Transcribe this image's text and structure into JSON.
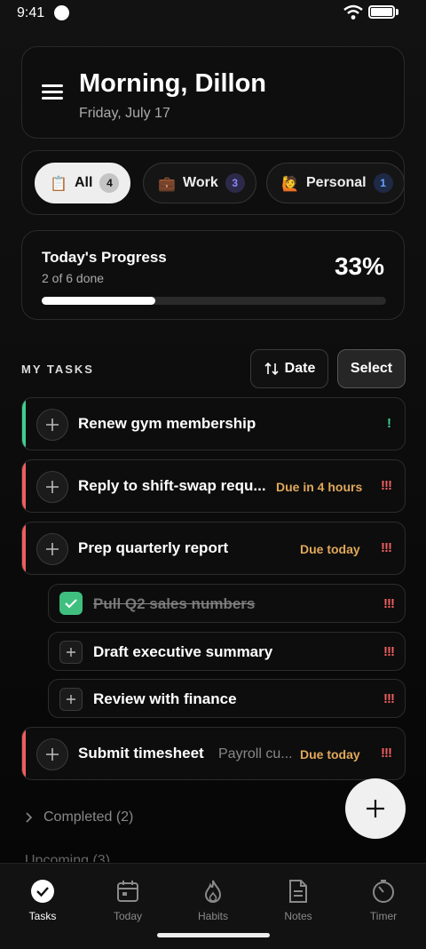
{
  "status": {
    "time": "9:41"
  },
  "header": {
    "title": "Morning, Dillon",
    "date": "Friday, July 17"
  },
  "filters": [
    {
      "label": "All",
      "count": "4",
      "icon": "clipboard-icon",
      "active": true
    },
    {
      "label": "Work",
      "count": "3",
      "icon": "briefcase-icon",
      "active": false
    },
    {
      "label": "Personal",
      "count": "1",
      "icon": "person-raising-hand-icon",
      "active": false
    }
  ],
  "progress": {
    "title": "Today's Progress",
    "subtitle": "2 of 6 done",
    "percent_label": "33%",
    "fraction": 0.33
  },
  "tasks_section": {
    "label": "MY TASKS",
    "sort_label": "Date",
    "select_label": "Select"
  },
  "tasks": [
    {
      "title": "Renew gym membership",
      "due": "",
      "priority": "!",
      "accent": "#3fcf8e"
    },
    {
      "title": "Reply to shift-swap requ...",
      "due": "Due in 4 hours",
      "priority": "!!!",
      "accent": "#ef5e5e"
    },
    {
      "title": "Prep quarterly report",
      "due": "Due today",
      "priority": "!!!",
      "accent": "#ef5e5e"
    }
  ],
  "subtasks": [
    {
      "title": "Pull Q2 sales numbers",
      "done": true,
      "priority": "!!!"
    },
    {
      "title": "Draft executive summary",
      "done": false,
      "priority": "!!!"
    },
    {
      "title": "Review with finance",
      "done": false,
      "priority": "!!!"
    }
  ],
  "task_last": {
    "title": "Submit timesheet",
    "note": "Payroll cu...",
    "due": "Due today",
    "priority": "!!!",
    "accent": "#ef5e5e"
  },
  "completed": {
    "label": "Completed (2)"
  },
  "peek_label": "Upcoming (3)",
  "nav": [
    {
      "label": "Tasks",
      "icon": "check-circle-icon",
      "active": true
    },
    {
      "label": "Today",
      "icon": "calendar-icon",
      "active": false
    },
    {
      "label": "Habits",
      "icon": "flame-icon",
      "active": false
    },
    {
      "label": "Notes",
      "icon": "document-icon",
      "active": false
    },
    {
      "label": "Timer",
      "icon": "timer-icon",
      "active": false
    }
  ],
  "colors": {
    "accent_green": "#3fcf8e",
    "accent_red": "#ef5e5e",
    "due": "#e0a85a"
  }
}
